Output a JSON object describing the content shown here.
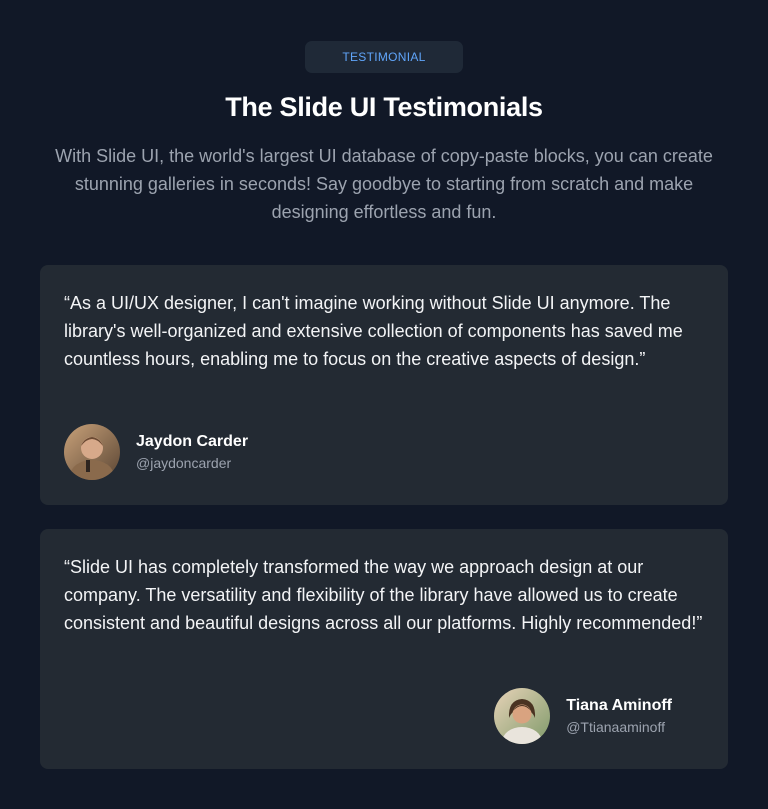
{
  "header": {
    "badge": "TESTIMONIAL",
    "title": "The Slide UI Testimonials",
    "subtitle": "With Slide UI, the world's largest UI database of copy-paste blocks, you can create stunning galleries in seconds! Say goodbye to starting from scratch and make designing effortless and fun."
  },
  "testimonials": [
    {
      "quote": "“As a UI/UX designer, I can't imagine working without Slide UI anymore. The library's well-organized and extensive collection of components has saved me countless hours, enabling me to focus on the creative aspects of design.”",
      "name": "Jaydon Carder",
      "handle": "@jaydoncarder",
      "avatar_icon": "person-avatar-icon"
    },
    {
      "quote": "“Slide UI has completely transformed the way we approach design at our company. The versatility and flexibility of the library have allowed us to create consistent and beautiful designs across all our platforms. Highly recommended!”",
      "name": "Tiana Aminoff",
      "handle": "@Ttianaaminoff",
      "avatar_icon": "person-avatar-icon"
    }
  ],
  "colors": {
    "background": "#111827",
    "card": "#232a33",
    "accent": "#60a5fa",
    "text_muted": "#9ca3af"
  }
}
